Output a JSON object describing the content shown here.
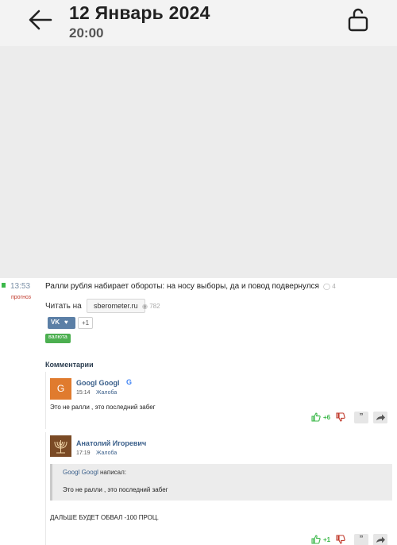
{
  "header": {
    "title": "12 Январь 2024",
    "subtitle": "20:00",
    "back_icon": "arrow-left-icon",
    "lock_icon": "unlock-icon"
  },
  "news": {
    "time": "13:53",
    "tag": "прогноз",
    "headline": "Ралли рубля набирает обороты: на носу выборы, да и повод подвернулся",
    "comment_count": "4",
    "read_label": "Читать на",
    "source": "sberometer.ru",
    "views": "782",
    "share_vk": "VK",
    "share_count": "+1",
    "category": "валюта"
  },
  "comments_title": "Комментарии",
  "comments": [
    {
      "avatar_letter": "G",
      "author": "Googl Googl",
      "time": "15:14",
      "complain": "Жалоба",
      "text": "Это не ралли , это последний забег",
      "rating": "+6",
      "quote_icon": "quote-icon",
      "reply_icon": "reply-arrow-icon"
    },
    {
      "author": "Анатолий Игоревич",
      "time": "17:19",
      "complain": "Жалоба",
      "quote": {
        "author": "Googl Googl",
        "wrote": "написал:",
        "text": "Это не ралли , это последний забег"
      },
      "text": "ДАЛЬШЕ БУДЕТ ОБВАЛ -100 ПРОЦ.",
      "rating": "+1"
    }
  ],
  "colors": {
    "accent_green": "#3cb84a",
    "link_blue": "#3a5f8a",
    "tag_red": "#c0392b",
    "vk_blue": "#5b7fa6"
  }
}
